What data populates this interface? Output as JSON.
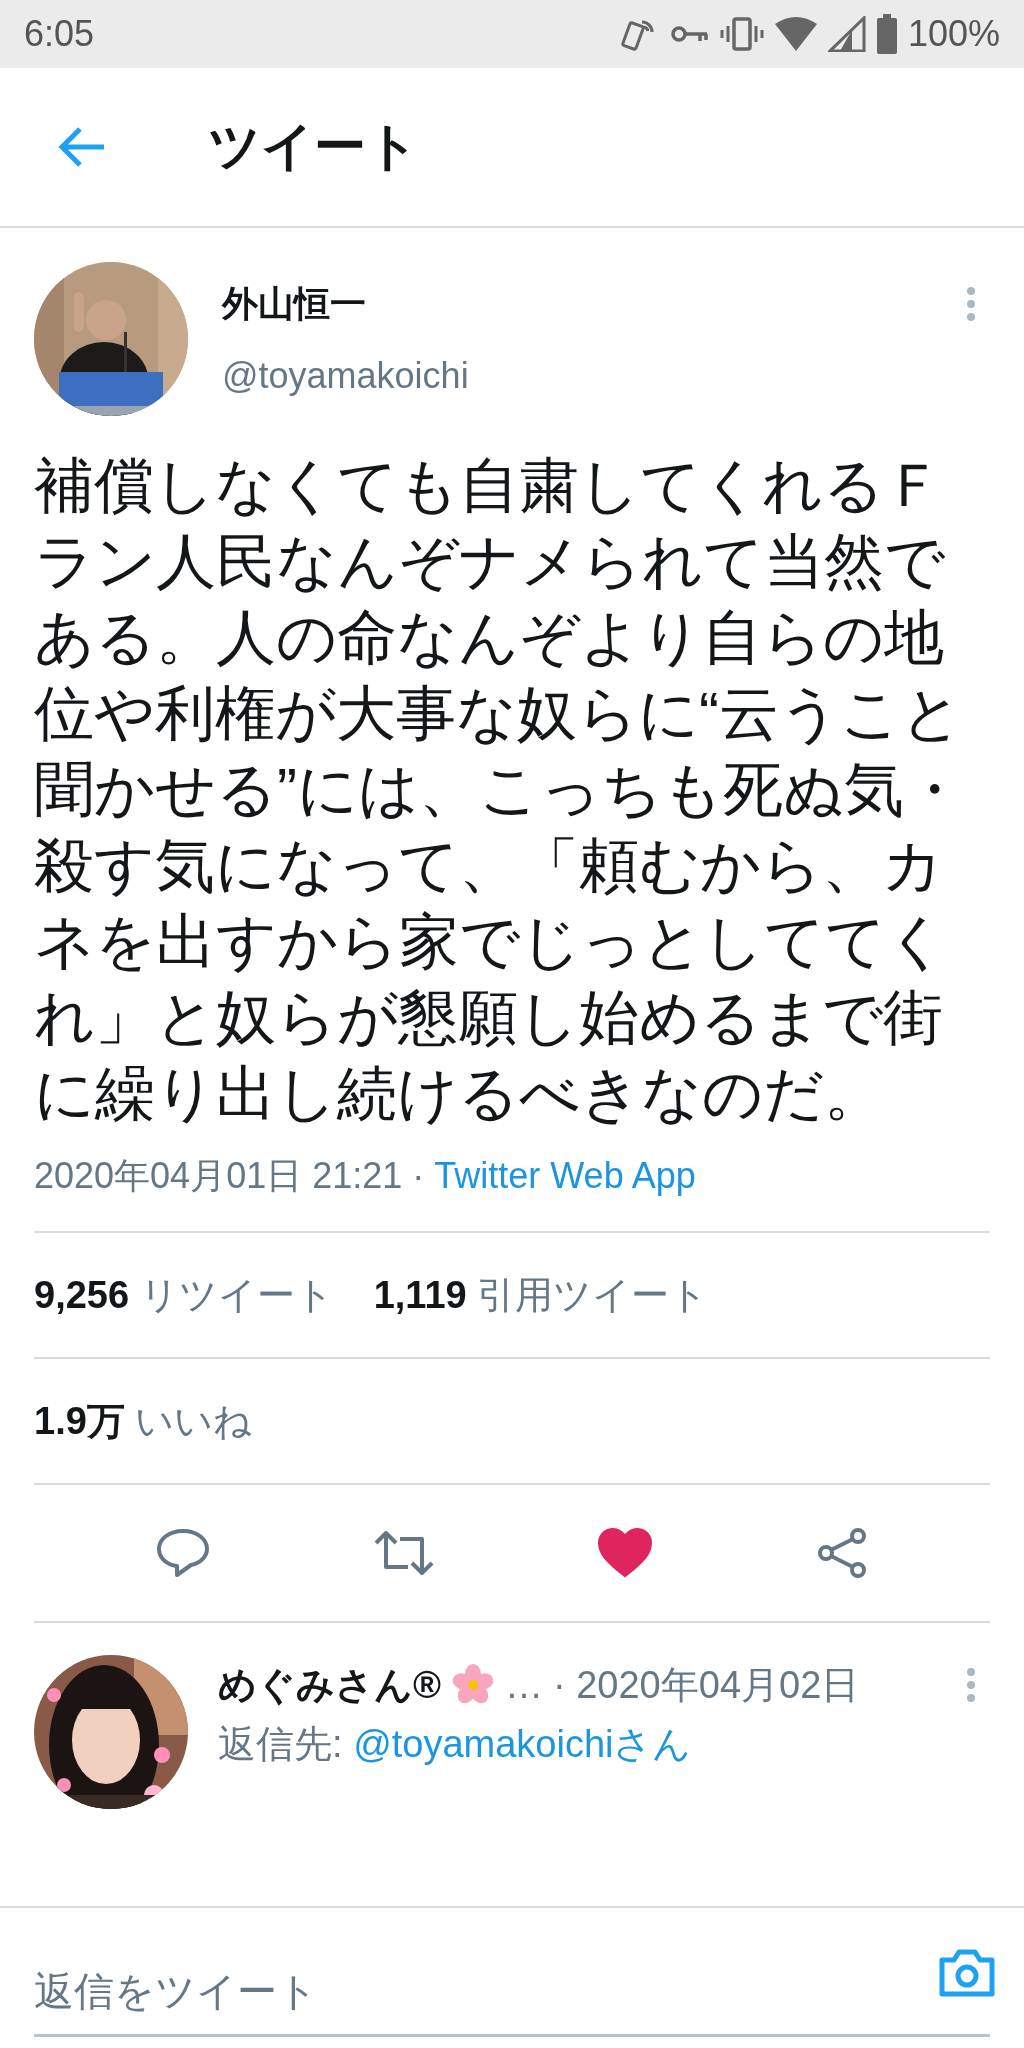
{
  "status_bar": {
    "time": "6:05",
    "battery": "100%"
  },
  "header": {
    "title": "ツイート"
  },
  "tweet": {
    "author": {
      "name": "外山恒一",
      "handle": "@toyamakoichi"
    },
    "text": "補償しなくても自粛してくれるＦラン人民なんぞナメられて当然である。人の命なんぞより自らの地位や利権が大事な奴らに“云うこと聞かせる”には、こっちも死ぬ気・殺す気になって、「頼むから、カネを出すから家でじっとしててくれ」と奴らが懇願し始めるまで街に繰り出し続けるべきなのだ。",
    "timestamp": "2020年04月01日 21:21 · ",
    "source": "Twitter Web App",
    "stats": [
      {
        "count": "9,256",
        "label": "リツイート"
      },
      {
        "count": "1,119",
        "label": "引用ツイート"
      }
    ],
    "likes": {
      "count": "1.9万",
      "label": "いいね"
    },
    "actions": [
      {
        "kind": "reply",
        "selected": false
      },
      {
        "kind": "retweet",
        "selected": false
      },
      {
        "kind": "like",
        "selected": true
      },
      {
        "kind": "share",
        "selected": false
      }
    ]
  },
  "reply": {
    "author": {
      "name": "めぐみさん®",
      "truncation": "…"
    },
    "date": "· 2020年04月02日",
    "reply_to_label": "返信先: ",
    "reply_to_handle": "@toyamakoichiさん"
  },
  "composer": {
    "placeholder": "返信をツイート"
  }
}
